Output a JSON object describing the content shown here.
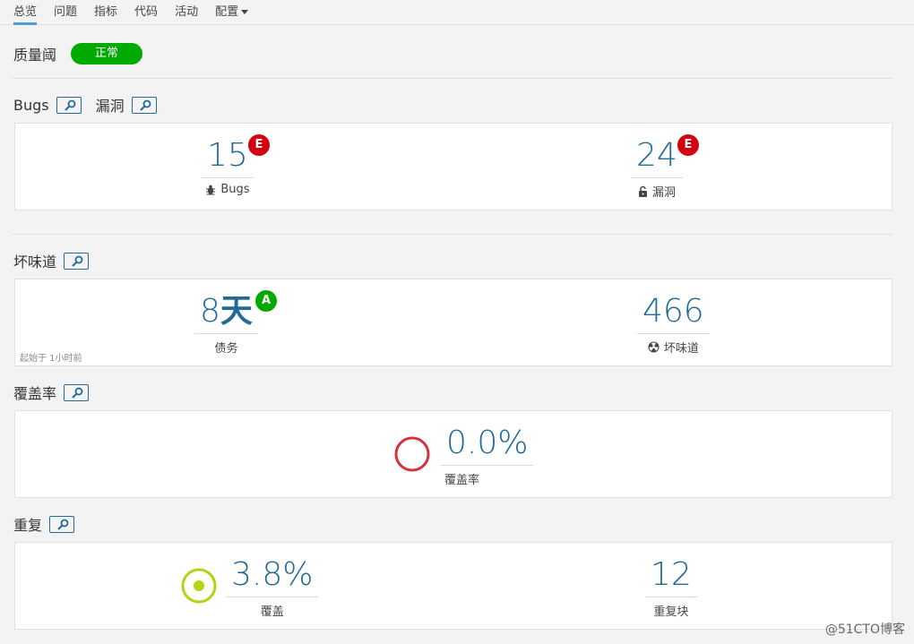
{
  "nav": {
    "tabs": [
      "总览",
      "问题",
      "指标",
      "代码",
      "活动",
      "配置"
    ]
  },
  "quality_gate": {
    "label": "质量阈",
    "status": "正常",
    "status_color": "#00aa00"
  },
  "bugs_section": {
    "title_bugs": "Bugs",
    "title_vuln": "漏洞",
    "bugs": {
      "value": "15",
      "rating": "E",
      "label": "Bugs",
      "icon": "bug-icon"
    },
    "vulnerabilities": {
      "value": "24",
      "rating": "E",
      "label": "漏洞",
      "icon": "lock-open-icon"
    },
    "rating_color": "#d4000f"
  },
  "code_smells_section": {
    "title": "坏味道",
    "debt": {
      "value_num": "8",
      "value_unit": "天",
      "rating": "A",
      "label": "债务"
    },
    "smells": {
      "value": "466",
      "label": "坏味道",
      "icon": "radiation-icon"
    },
    "since": "起始于 1小时前",
    "rating_color": "#00aa00"
  },
  "coverage_section": {
    "title": "覆盖率",
    "coverage": {
      "value": "0.0%",
      "label": "覆盖率",
      "percent": 0.0,
      "ring_color": "#d4333f"
    }
  },
  "duplications_section": {
    "title": "重复",
    "duplication": {
      "value": "3.8%",
      "label": "覆盖",
      "percent": 3.8,
      "ring_color": "#b0d513"
    },
    "blocks": {
      "value": "12",
      "label": "重复块"
    }
  },
  "watermark": "@51CTO博客"
}
